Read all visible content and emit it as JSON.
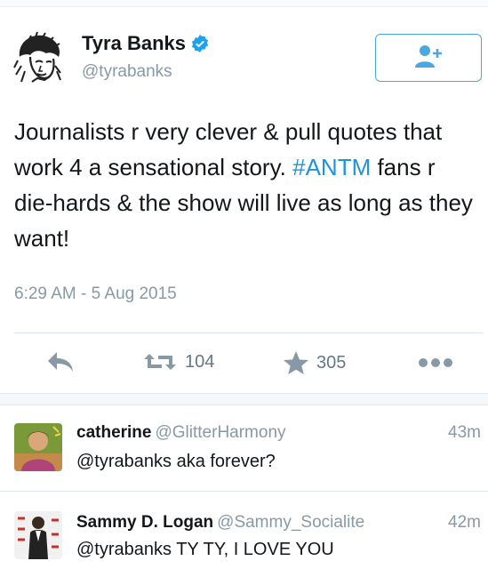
{
  "tweet": {
    "author_name": "Tyra Banks",
    "author_handle": "@tyrabanks",
    "text_part1": "Journalists r very clever & pull quotes that work 4 a sensational story. ",
    "hashtag": "#ANTM",
    "text_part2": " fans r die-hards & the show will live as long as they want!",
    "timestamp": "6:29 AM - 5 Aug 2015",
    "retweet_count": "104",
    "like_count": "305",
    "accent_color": "#1b95e0"
  },
  "icons": {
    "verified": "verified-badge-icon",
    "follow": "add-user-icon",
    "reply": "reply-arrow-icon",
    "retweet": "retweet-icon",
    "like": "star-icon",
    "more": "more-dots-icon"
  },
  "replies": [
    {
      "name": "catherine",
      "handle": "@GlitterHarmony",
      "time": "43m",
      "text": "@tyrabanks aka forever?"
    },
    {
      "name": "Sammy D. Logan",
      "handle": "@Sammy_Socialite",
      "time": "42m",
      "text": "@tyrabanks TY TY, I LOVE YOU"
    }
  ]
}
